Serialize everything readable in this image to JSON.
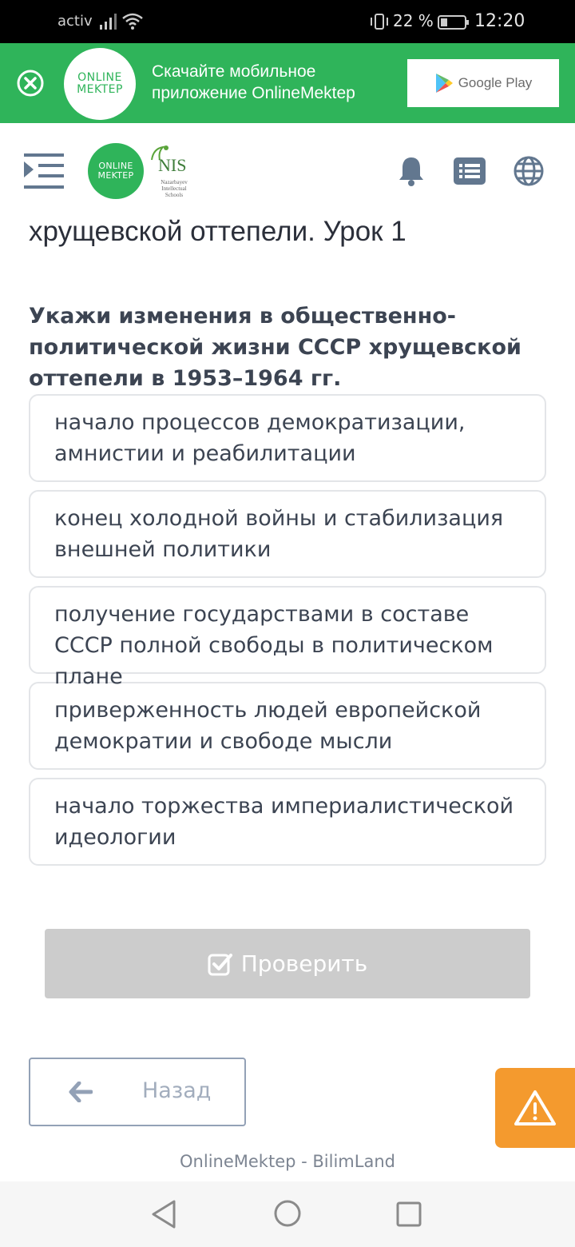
{
  "status_bar": {
    "carrier": "activ",
    "battery_percent": "22 %",
    "time": "12:20"
  },
  "promo_banner": {
    "logo_line1": "ONLINE",
    "logo_line2": "MEKTEP",
    "text": "Скачайте мобильное приложение OnlineMektep",
    "store_label": "Google Play",
    "color": "#2fb45a"
  },
  "header": {
    "logo_line1": "ONLINE",
    "logo_line2": "MEKTEP",
    "partner_logo": "NIS",
    "partner_subtitle": "Nazarbayev Intellectual Schools",
    "icons": [
      "menu-icon",
      "bell-icon",
      "list-icon",
      "globe-icon"
    ]
  },
  "lesson": {
    "title": "хрущевской оттепели. Урок 1"
  },
  "question": {
    "text": "Укажи изменения в общественно-политической жизни СССР хрущевской оттепели в 1953–1964 гг.",
    "options": [
      "начало процессов демократизации, амнистии и реабилитации",
      "конец холодной войны и стабилизация внешней политики",
      "получение государствами в составе СССР полной свободы в политическом плане",
      "приверженность людей европейской демократии и свободе мысли",
      "начало торжества империалистической идеологии"
    ]
  },
  "actions": {
    "check_label": "Проверить",
    "back_label": "Назад",
    "report_icon": "warning-icon",
    "report_color": "#f49a2e"
  },
  "footer": {
    "text": "OnlineMektep - BilimLand"
  }
}
